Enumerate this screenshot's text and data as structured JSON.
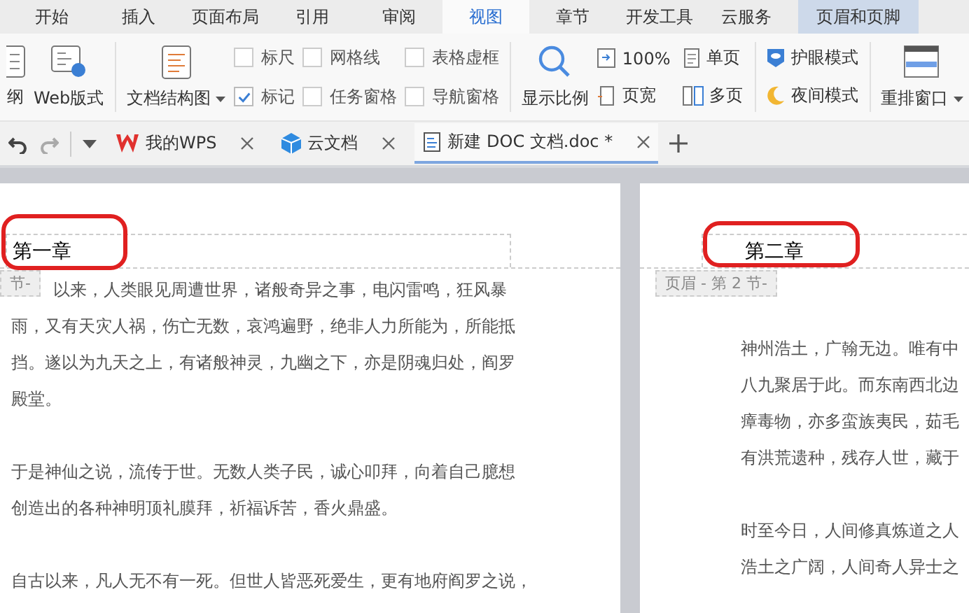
{
  "menu_tabs": [
    {
      "label": "开始",
      "selected": false,
      "kind": "normal"
    },
    {
      "label": "插入",
      "selected": false,
      "kind": "normal"
    },
    {
      "label": "页面布局",
      "selected": false,
      "kind": "normal"
    },
    {
      "label": "引用",
      "selected": false,
      "kind": "normal"
    },
    {
      "label": "审阅",
      "selected": false,
      "kind": "normal"
    },
    {
      "label": "视图",
      "selected": true,
      "kind": "normal"
    },
    {
      "label": "章节",
      "selected": false,
      "kind": "normal"
    },
    {
      "label": "开发工具",
      "selected": false,
      "kind": "normal"
    },
    {
      "label": "云服务",
      "selected": false,
      "kind": "normal"
    },
    {
      "label": "页眉和页脚",
      "selected": false,
      "kind": "contextual"
    }
  ],
  "ribbon": {
    "outline_label": "纲",
    "web_layout_label": "Web版式",
    "doc_map_label": "文档结构图",
    "checkboxes": [
      {
        "label": "标尺",
        "checked": false
      },
      {
        "label": "标记",
        "checked": true
      },
      {
        "label": "网格线",
        "checked": false
      },
      {
        "label": "任务窗格",
        "checked": false
      },
      {
        "label": "表格虚框",
        "checked": false
      },
      {
        "label": "导航窗格",
        "checked": false
      }
    ],
    "zoom_label": "显示比例",
    "zoom_100": "100%",
    "page_width": "页宽",
    "single_page": "单页",
    "multi_page": "多页",
    "eye_mode": "护眼模式",
    "night_mode": "夜间模式",
    "rearrange": "重排窗口"
  },
  "doc_tabs": [
    {
      "label": "我的WPS",
      "selected": false,
      "kind": "wps"
    },
    {
      "label": "云文档",
      "selected": false,
      "kind": "cloud"
    },
    {
      "label": "新建 DOC 文档.doc *",
      "selected": true,
      "kind": "doc"
    }
  ],
  "pages": [
    {
      "header": "第一章",
      "header_tag": "节-",
      "paragraphs": [
        [
          "以来，人类眼见周遭世界，诸般奇异之事，电闪雷鸣，狂风暴",
          "雨，又有天灾人祸，伤亡无数，哀鸿遍野，绝非人力所能为，所能抵",
          "挡。遂以为九天之上，有诸般神灵，九幽之下，亦是阴魂归处，阎罗",
          "殿堂。"
        ],
        [
          "于是神仙之说，流传于世。无数人类子民，诚心叩拜，向着自己臆想",
          "创造出的各种神明顶礼膜拜，祈福诉苦，香火鼎盛。"
        ],
        [
          "自古以来，凡人无不有一死。但世人皆恶死爱生，更有地府阎罗之说，"
        ]
      ]
    },
    {
      "header": "第二章",
      "header_tag": "页眉  - 第 2 节-",
      "paragraphs": [
        [
          "神州浩土，广翰无边。唯有中",
          "八九聚居于此。而东南西北边",
          "瘴毒物，亦多蛮族夷民，茹毛",
          "有洪荒遗种，残存人世，藏于"
        ],
        [
          "时至今日，人间修真炼道之人",
          "浩土之广阔，人间奇人异士之"
        ]
      ]
    }
  ]
}
